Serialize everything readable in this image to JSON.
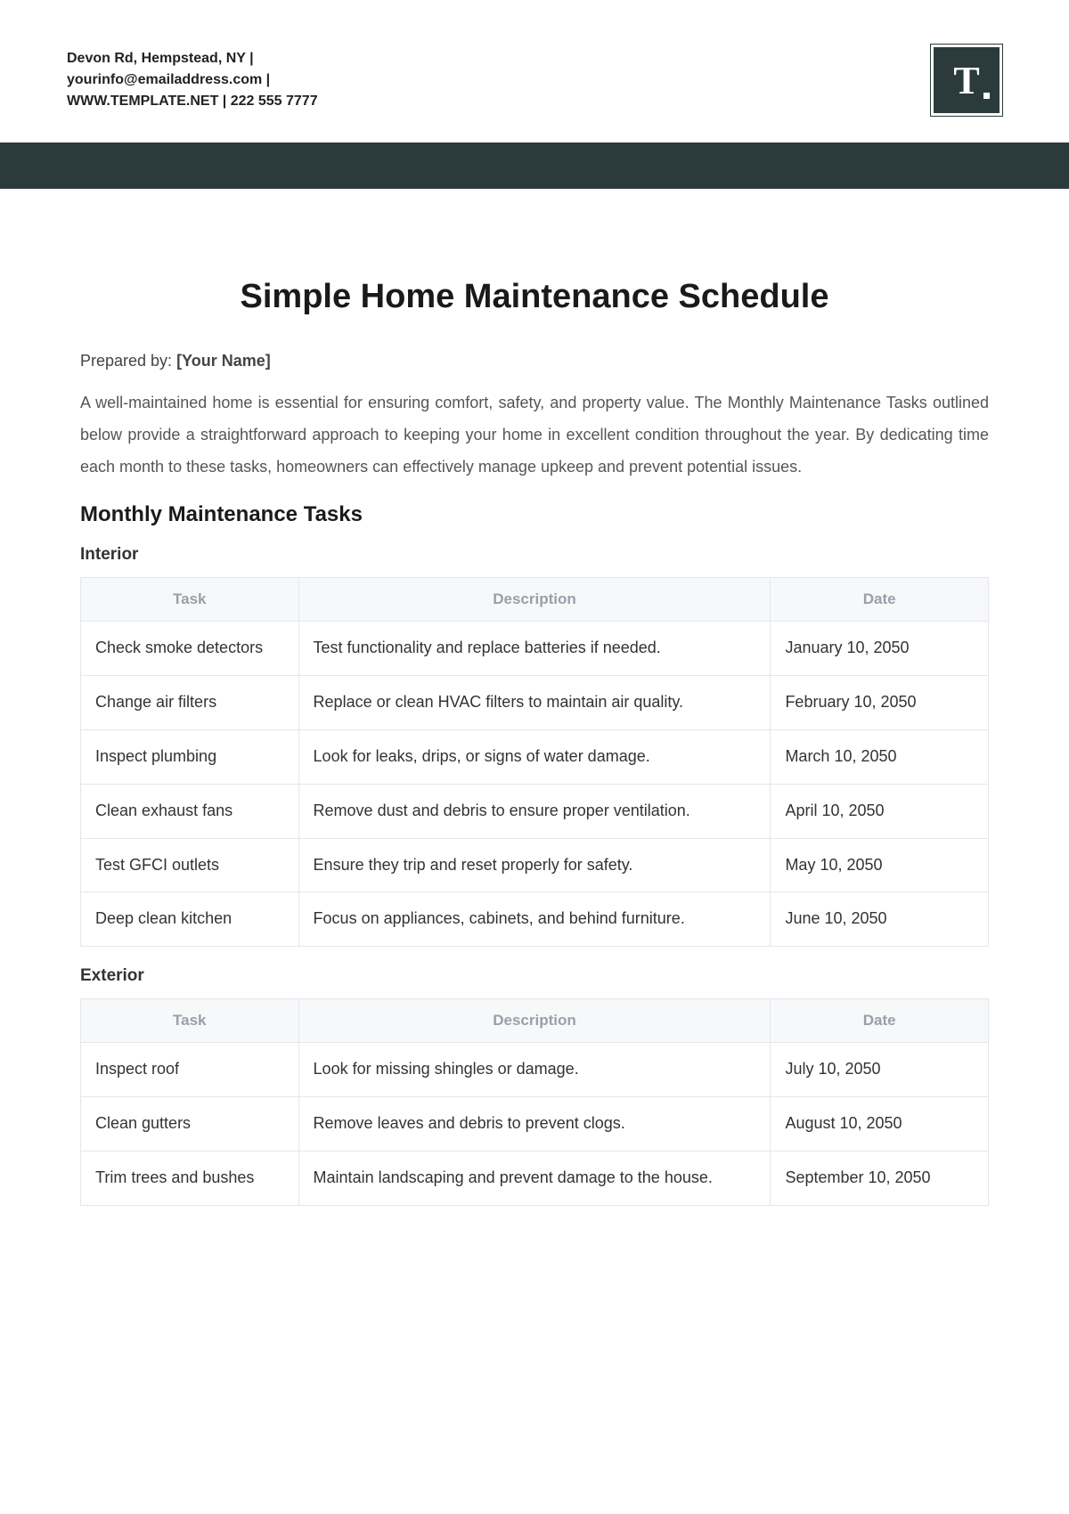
{
  "header": {
    "contact_line1": "Devon Rd, Hempstead, NY |",
    "contact_line2": "yourinfo@emailaddress.com |",
    "contact_line3": "WWW.TEMPLATE.NET | 222 555 7777",
    "logo_letter": "T"
  },
  "title": "Simple Home Maintenance Schedule",
  "prepared_by": {
    "label": "Prepared by: ",
    "value": "[Your Name]"
  },
  "intro": "A well-maintained home is essential for ensuring comfort, safety, and property value. The Monthly Maintenance Tasks outlined below provide a straightforward approach to keeping your home in excellent condition throughout the year. By dedicating time each month to these tasks, homeowners can effectively manage upkeep and prevent potential issues.",
  "section_heading": "Monthly Maintenance Tasks",
  "columns": {
    "task": "Task",
    "description": "Description",
    "date": "Date"
  },
  "interior": {
    "heading": "Interior",
    "rows": [
      {
        "task": "Check smoke detectors",
        "description": "Test functionality and replace batteries if needed.",
        "date": "January 10, 2050"
      },
      {
        "task": "Change air filters",
        "description": "Replace or clean HVAC filters to maintain air quality.",
        "date": "February 10, 2050"
      },
      {
        "task": "Inspect plumbing",
        "description": "Look for leaks, drips, or signs of water damage.",
        "date": "March 10, 2050"
      },
      {
        "task": "Clean exhaust fans",
        "description": "Remove dust and debris to ensure proper ventilation.",
        "date": "April 10, 2050"
      },
      {
        "task": "Test GFCI outlets",
        "description": "Ensure they trip and reset properly for safety.",
        "date": "May 10, 2050"
      },
      {
        "task": "Deep clean kitchen",
        "description": "Focus on appliances, cabinets, and behind furniture.",
        "date": "June 10, 2050"
      }
    ]
  },
  "exterior": {
    "heading": "Exterior",
    "rows": [
      {
        "task": "Inspect roof",
        "description": "Look for missing shingles or damage.",
        "date": "July 10, 2050"
      },
      {
        "task": "Clean gutters",
        "description": "Remove leaves and debris to prevent clogs.",
        "date": "August 10, 2050"
      },
      {
        "task": "Trim trees and bushes",
        "description": "Maintain landscaping and prevent damage to the house.",
        "date": "September 10, 2050"
      }
    ]
  }
}
